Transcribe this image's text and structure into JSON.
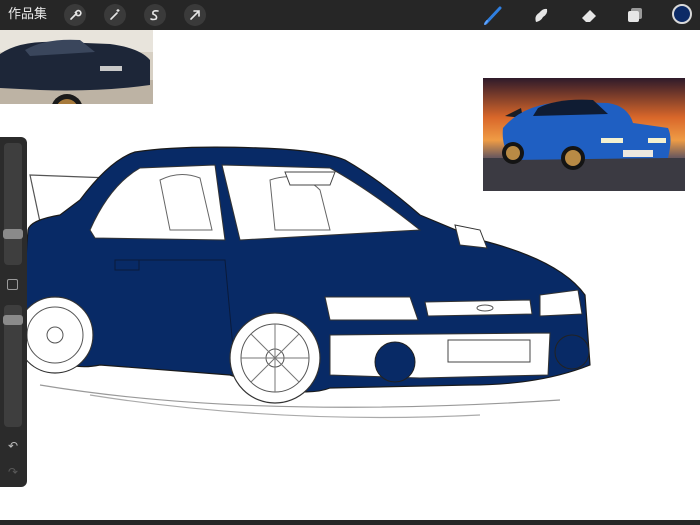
{
  "topbar": {
    "gallery_label": "作品集",
    "left_tools": [
      {
        "name": "actions-wrench-icon"
      },
      {
        "name": "adjustments-wand-icon"
      },
      {
        "name": "selection-s-icon"
      },
      {
        "name": "transform-arrow-icon"
      }
    ],
    "right_tools": [
      {
        "name": "brush-icon",
        "active": true
      },
      {
        "name": "smudge-icon"
      },
      {
        "name": "eraser-icon"
      },
      {
        "name": "layers-icon"
      }
    ],
    "current_color": "#0c2a66",
    "active_tool_color": "#2f7fe0"
  },
  "canvas": {
    "fill_color": "#082a66"
  },
  "sidebar": {
    "undo_icon": "↶",
    "redo_icon": "↷"
  }
}
